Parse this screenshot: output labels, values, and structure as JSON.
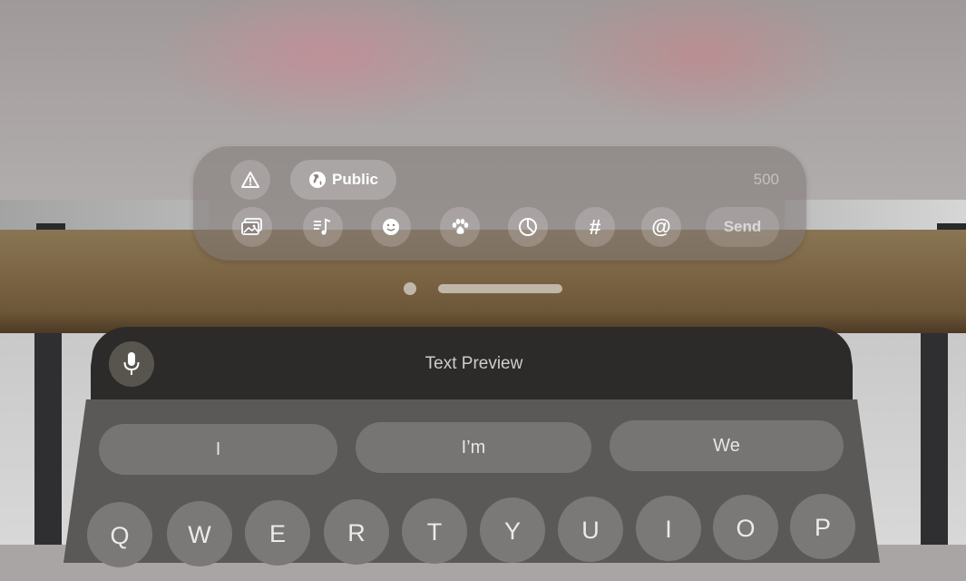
{
  "compose_bar": {
    "visibility_label": "Public",
    "char_counter": "500",
    "send_label": "Send",
    "top_icons": [
      "content-warning-icon",
      "globe-icon"
    ],
    "tool_icons": [
      "media-icon",
      "audio-icon",
      "emoji-icon",
      "pet-icon",
      "poll-icon",
      "hashtag-icon",
      "mention-icon"
    ],
    "hashtag_glyph": "#",
    "mention_glyph": "@"
  },
  "pager": {
    "pages": 2,
    "current": 2
  },
  "keyboard": {
    "preview_text": "Text Preview",
    "suggestions": [
      "I",
      "I’m",
      "We"
    ],
    "row1": [
      "Q",
      "W",
      "E",
      "R",
      "T",
      "Y",
      "U",
      "I",
      "O",
      "P"
    ]
  }
}
